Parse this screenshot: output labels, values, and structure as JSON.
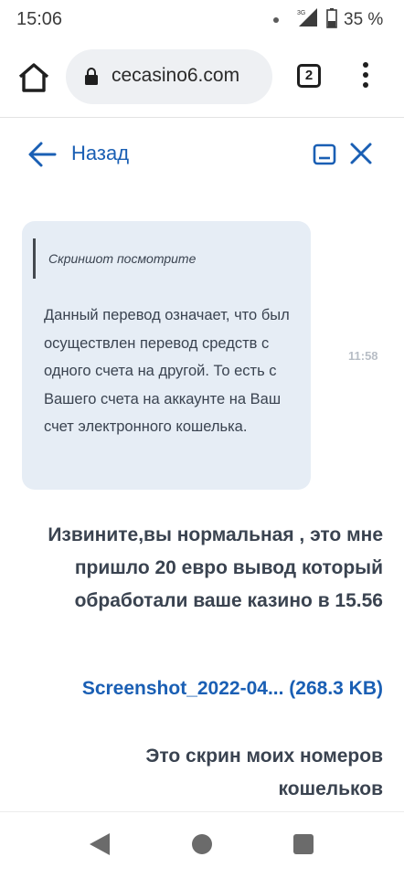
{
  "status_bar": {
    "time": "15:06",
    "network": "3G",
    "battery_percent": "35 %"
  },
  "browser": {
    "url": "cecasino6.com",
    "tab_count": "2",
    "icons": [
      "home-icon",
      "lock-icon",
      "tabs-icon",
      "more-vert-icon"
    ]
  },
  "chat_header": {
    "back_label": "Назад",
    "icons": [
      "arrow-left-icon",
      "minimize-icon",
      "close-icon"
    ],
    "accent_color": "#1a5fb4"
  },
  "messages": [
    {
      "from": "agent",
      "quote": "Скриншот посмотрите",
      "text": "Данный перевод означает, что был осуществлен перевод средств с одного счета на другой. То есть с Вашего счета на аккаунте на Ваш счет электронного кошелька.",
      "time": "11:58",
      "bubble_color": "#e6edf5"
    },
    {
      "from": "user",
      "text": "Извините,вы нормальная , это мне пришло 20 евро вывод который обработали ваше казино в 15.56"
    },
    {
      "from": "user",
      "attachment": "Screenshot_2022-04... (268.3 KB)"
    },
    {
      "from": "user",
      "text": "Это скрин моих номеров кошельков"
    }
  ],
  "nav_bar": {
    "icons": [
      "nav-back-icon",
      "nav-home-icon",
      "nav-recents-icon"
    ]
  }
}
